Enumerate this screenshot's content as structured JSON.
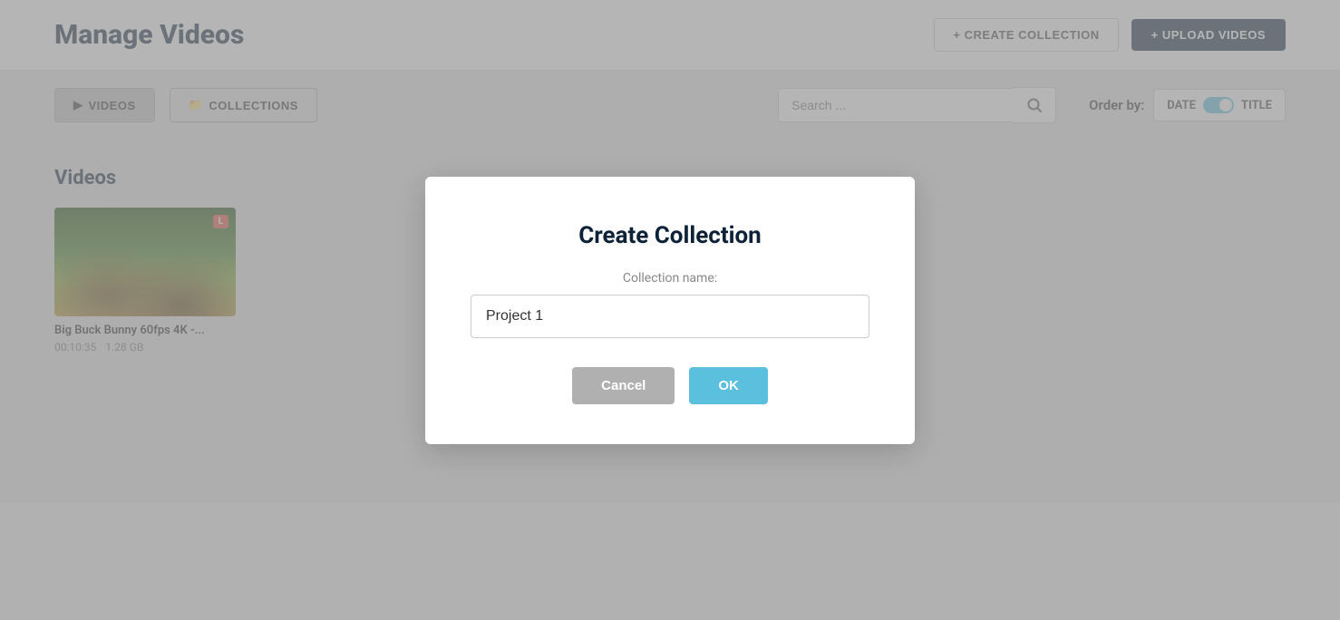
{
  "header": {
    "title": "Manage Videos",
    "btn_create_collection": "+ CREATE COLLECTION",
    "btn_upload_videos": "+ UPLOAD VIDEOS"
  },
  "toolbar": {
    "tab_videos_label": "VIDEOS",
    "tab_collections_label": "COLLECTIONS",
    "search_placeholder": "Search ...",
    "order_by_label": "Order by:",
    "order_date_label": "DATE",
    "order_title_label": "TITLE"
  },
  "main": {
    "section_title": "Videos",
    "video": {
      "name": "Big Buck Bunny 60fps 4K -...",
      "duration": "00:10:35",
      "size": "1.28 GB",
      "badge": "L"
    }
  },
  "modal": {
    "title": "Create Collection",
    "label": "Collection name:",
    "input_value": "Project 1",
    "btn_cancel": "Cancel",
    "btn_ok": "OK"
  }
}
